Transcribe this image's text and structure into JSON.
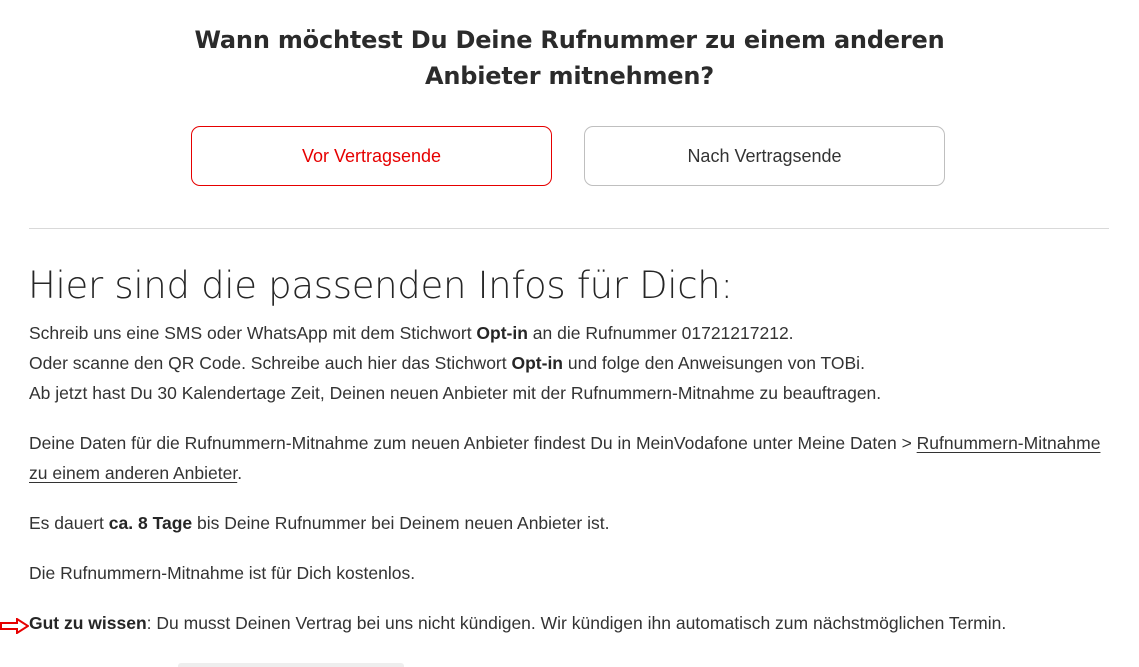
{
  "question": {
    "line1": "Wann möchtest Du Deine Rufnummer zu einem anderen",
    "line2": "Anbieter mitnehmen?"
  },
  "options": [
    {
      "label": "Vor Vertragsende",
      "selected": true
    },
    {
      "label": "Nach Vertragsende",
      "selected": false
    }
  ],
  "info": {
    "title": "Hier sind die passenden Infos für Dich:",
    "p1": {
      "a1": "Schreib uns eine SMS oder WhatsApp mit dem Stichwort ",
      "b1": "Opt-in",
      "a2": " an die Rufnummer 01721217212.",
      "a3": "Oder scanne den QR Code. Schreibe auch hier das Stichwort ",
      "b2": "Opt-in",
      "a4": " und folge den Anweisungen von TOBi.",
      "a5": "Ab jetzt hast Du 30 Kalendertage Zeit, Deinen neuen Anbieter mit der Rufnummern-Mitnahme zu beauftragen."
    },
    "p2": {
      "text": "Deine Daten für die Rufnummern-Mitnahme zum neuen Anbieter findest Du in MeinVodafone unter Meine Daten > ",
      "link_line1": "Rufnummern-Mitnahme",
      "link_line2": "zu einem anderen Anbieter",
      "end": "."
    },
    "p3": {
      "a": "Es dauert ",
      "b": "ca. 8 Tage",
      "c": " bis Deine Rufnummer bei Deinem neuen Anbieter ist."
    },
    "p4": "Die Rufnummern-Mitnahme ist für Dich kostenlos.",
    "p5": {
      "b": "Gut zu wissen",
      "a": ": Du musst Deinen Vertrag bei uns nicht kündigen. Wir kündigen ihn automatisch zum nächstmöglichen Termin."
    }
  },
  "colors": {
    "accent": "#e60000",
    "text": "#333333",
    "border": "#bfbfbf",
    "divider": "#d9d9d9"
  },
  "icons": {
    "annotation": "red-arrow-icon"
  }
}
